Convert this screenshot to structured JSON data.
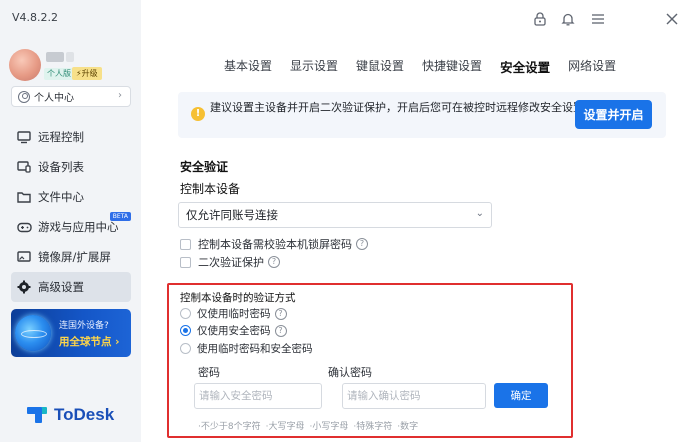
{
  "app": {
    "version": "V4.8.2.2",
    "logo_text": "ToDesk"
  },
  "user": {
    "plan_badge": "个人版",
    "upgrade_badge": "升级",
    "personal_center": "个人中心"
  },
  "nav": {
    "items": [
      {
        "label": "远程控制",
        "icon": "remote-control-icon"
      },
      {
        "label": "设备列表",
        "icon": "device-list-icon"
      },
      {
        "label": "文件中心",
        "icon": "folder-icon"
      },
      {
        "label": "游戏与应用中心",
        "icon": "gamepad-icon",
        "badge": "BETA"
      },
      {
        "label": "镜像屏/扩展屏",
        "icon": "mirror-screen-icon"
      },
      {
        "label": "高级设置",
        "icon": "gear-icon",
        "active": true
      }
    ]
  },
  "promo": {
    "line1": "连国外设备?",
    "line2": "用全球节点"
  },
  "header": {
    "icons": [
      "lock-icon",
      "bell-icon",
      "menu-icon",
      "close-icon"
    ]
  },
  "tabs": [
    "基本设置",
    "显示设置",
    "键鼠设置",
    "快捷键设置",
    "安全设置",
    "网络设置"
  ],
  "active_tab": "安全设置",
  "banner": {
    "text": "建议设置主设备并开启二次验证保护，开启后您可在被控时远程修改安全设置",
    "button": "设置并开启"
  },
  "security": {
    "title": "安全验证",
    "control_label": "控制本设备",
    "select_value": "仅允许同账号连接",
    "checkbox1": "控制本设备需校验本机锁屏密码",
    "checkbox2": "二次验证保护"
  },
  "verify": {
    "title": "控制本设备时的验证方式",
    "options": [
      "仅使用临时密码",
      "仅使用安全密码",
      "使用临时密码和安全密码"
    ],
    "selected_index": 1,
    "password_label": "密码",
    "password_placeholder": "请输入安全密码",
    "confirm_label": "确认密码",
    "confirm_placeholder": "请输入确认密码",
    "confirm_button": "确定",
    "hints": [
      "·不少于8个字符",
      "·大写字母",
      "·小写字母",
      "·特殊字符",
      "·数字"
    ]
  }
}
